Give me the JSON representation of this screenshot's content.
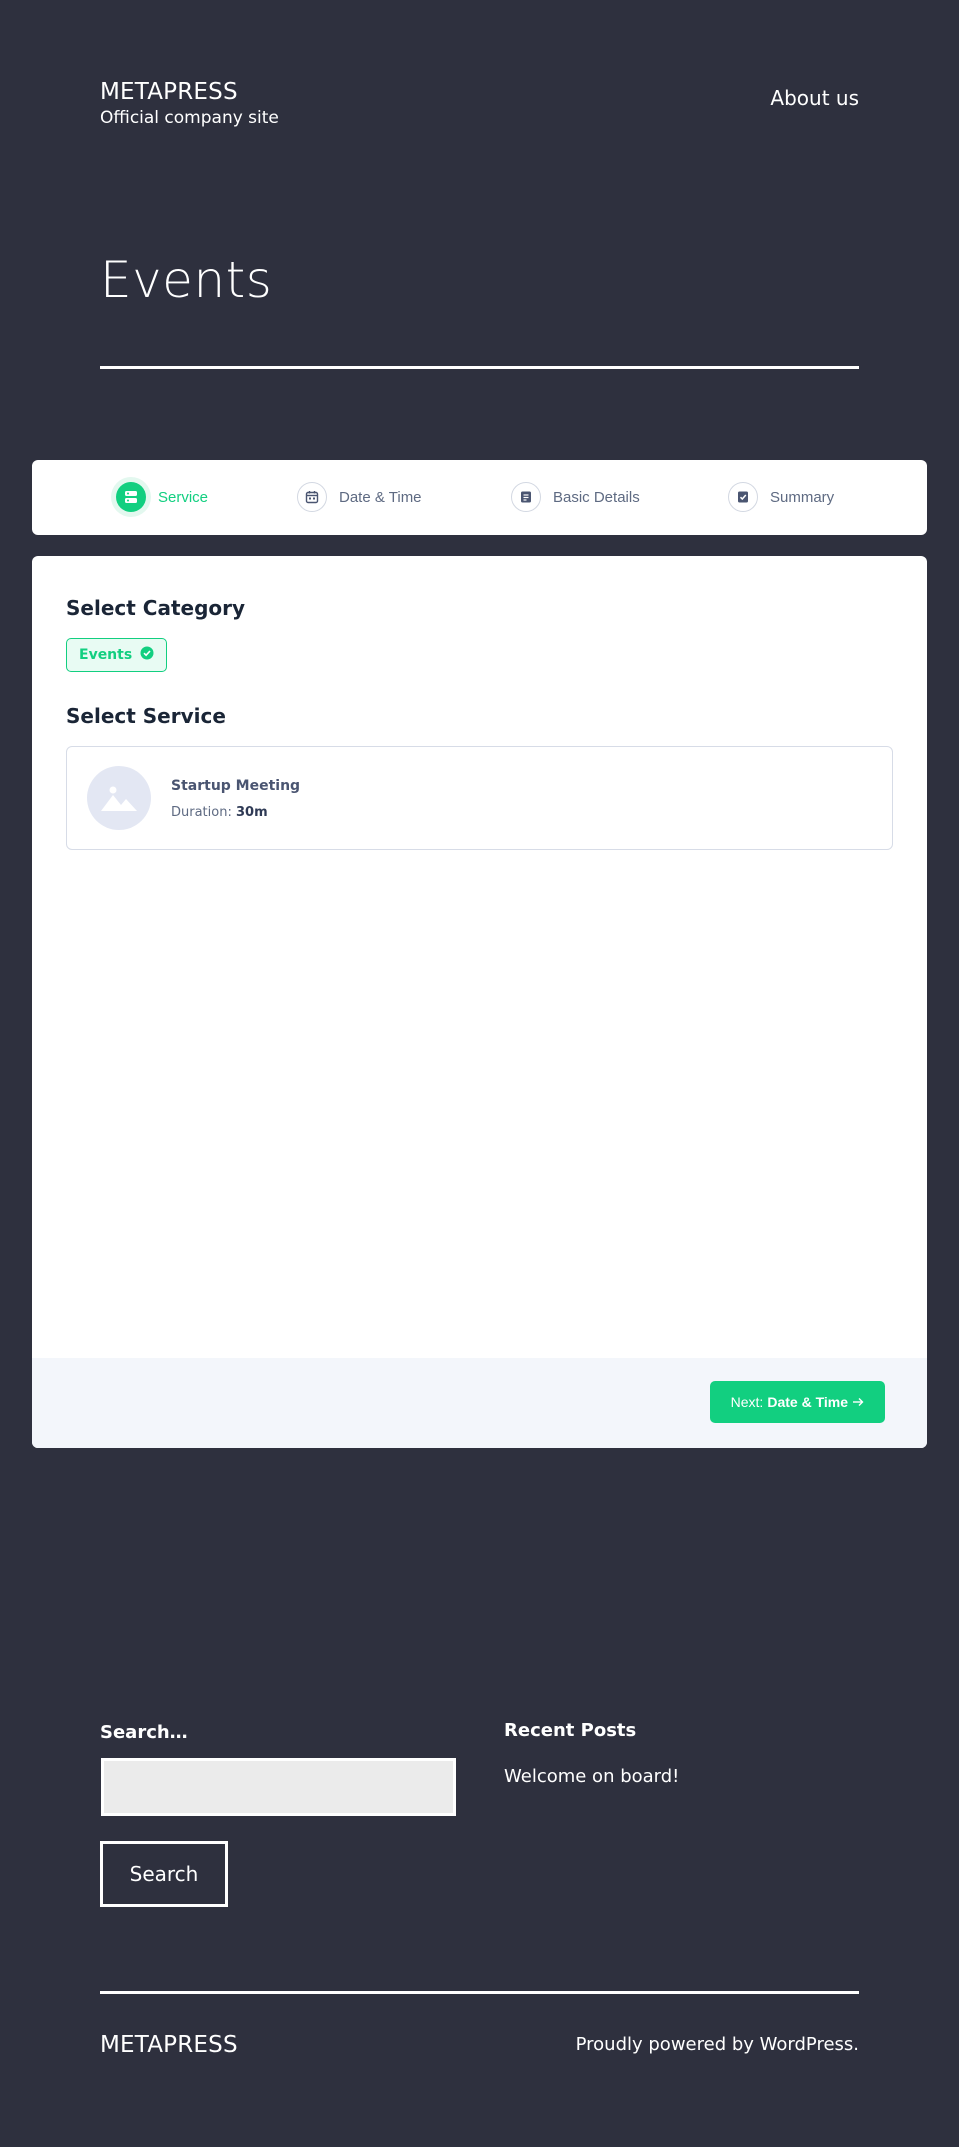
{
  "header": {
    "site_title": "METAPRESS",
    "site_description": "Official company site",
    "nav_about": "About us"
  },
  "page": {
    "title": "Events"
  },
  "booking": {
    "steps": [
      {
        "label": "Service",
        "icon": "service-icon",
        "active": true
      },
      {
        "label": "Date & Time",
        "icon": "calendar-icon",
        "active": false
      },
      {
        "label": "Basic Details",
        "icon": "document-icon",
        "active": false
      },
      {
        "label": "Summary",
        "icon": "checklist-icon",
        "active": false
      }
    ],
    "category_heading": "Select Category",
    "category_chip": "Events",
    "service_heading": "Select Service",
    "service": {
      "name": "Startup Meeting",
      "duration_label": "Duration:",
      "duration_value": "30m"
    },
    "next_prefix": "Next:",
    "next_target": "Date & Time",
    "accent_color": "#12cf80"
  },
  "widgets": {
    "search_label": "Search…",
    "search_button": "Search",
    "recent_posts_heading": "Recent Posts",
    "recent_posts": [
      "Welcome on board!"
    ]
  },
  "footer": {
    "site_title": "METAPRESS",
    "credit": "Proudly powered by WordPress."
  }
}
